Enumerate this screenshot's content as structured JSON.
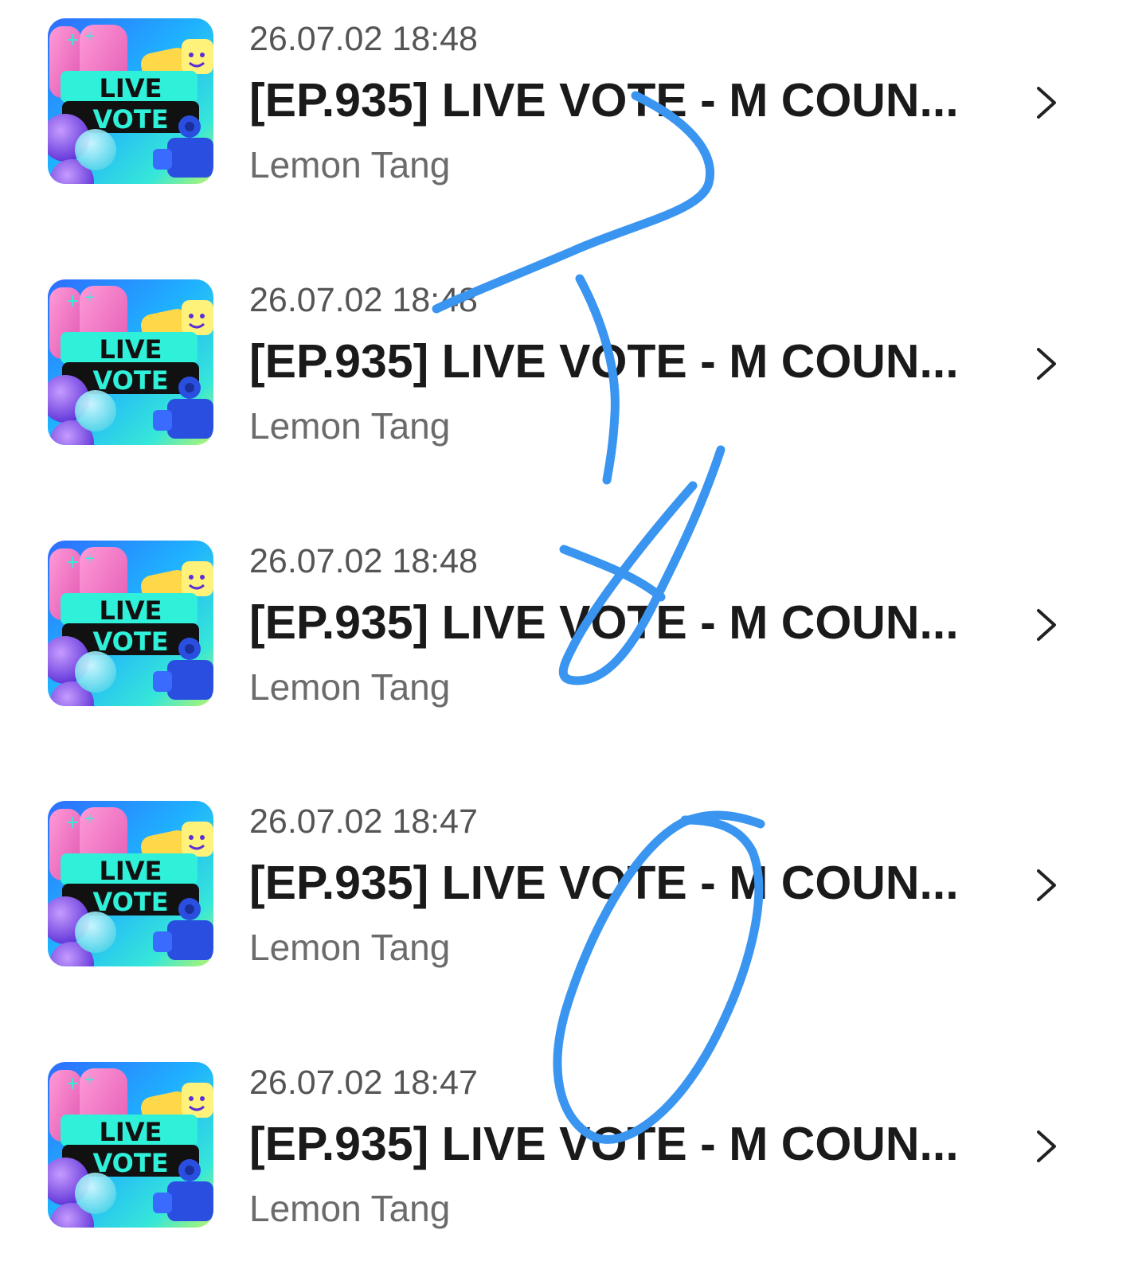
{
  "items": [
    {
      "date": "26.07.02 18:48",
      "title": "[EP.935] LIVE VOTE - M COUN...",
      "author": "Lemon Tang",
      "thumb_line1": "LIVE",
      "thumb_line2": "VOTE"
    },
    {
      "date": "26.07.02 18:48",
      "title": "[EP.935] LIVE VOTE - M COUN...",
      "author": "Lemon Tang",
      "thumb_line1": "LIVE",
      "thumb_line2": "VOTE"
    },
    {
      "date": "26.07.02 18:48",
      "title": "[EP.935] LIVE VOTE - M COUN...",
      "author": "Lemon Tang",
      "thumb_line1": "LIVE",
      "thumb_line2": "VOTE"
    },
    {
      "date": "26.07.02 18:47",
      "title": "[EP.935] LIVE VOTE - M COUN...",
      "author": "Lemon Tang",
      "thumb_line1": "LIVE",
      "thumb_line2": "VOTE"
    },
    {
      "date": "26.07.02 18:47",
      "title": "[EP.935] LIVE VOTE - M COUN...",
      "author": "Lemon Tang",
      "thumb_line1": "LIVE",
      "thumb_line2": "VOTE"
    }
  ],
  "icons": {
    "chevron": "chevron-right-icon",
    "thumbnail": "live-vote-thumbnail"
  },
  "colors": {
    "title": "#1a1a1a",
    "date": "#555555",
    "author": "#6b6b6b",
    "annotation_stroke": "#3a95f0",
    "thumb_banner": "#2ff0d8"
  }
}
